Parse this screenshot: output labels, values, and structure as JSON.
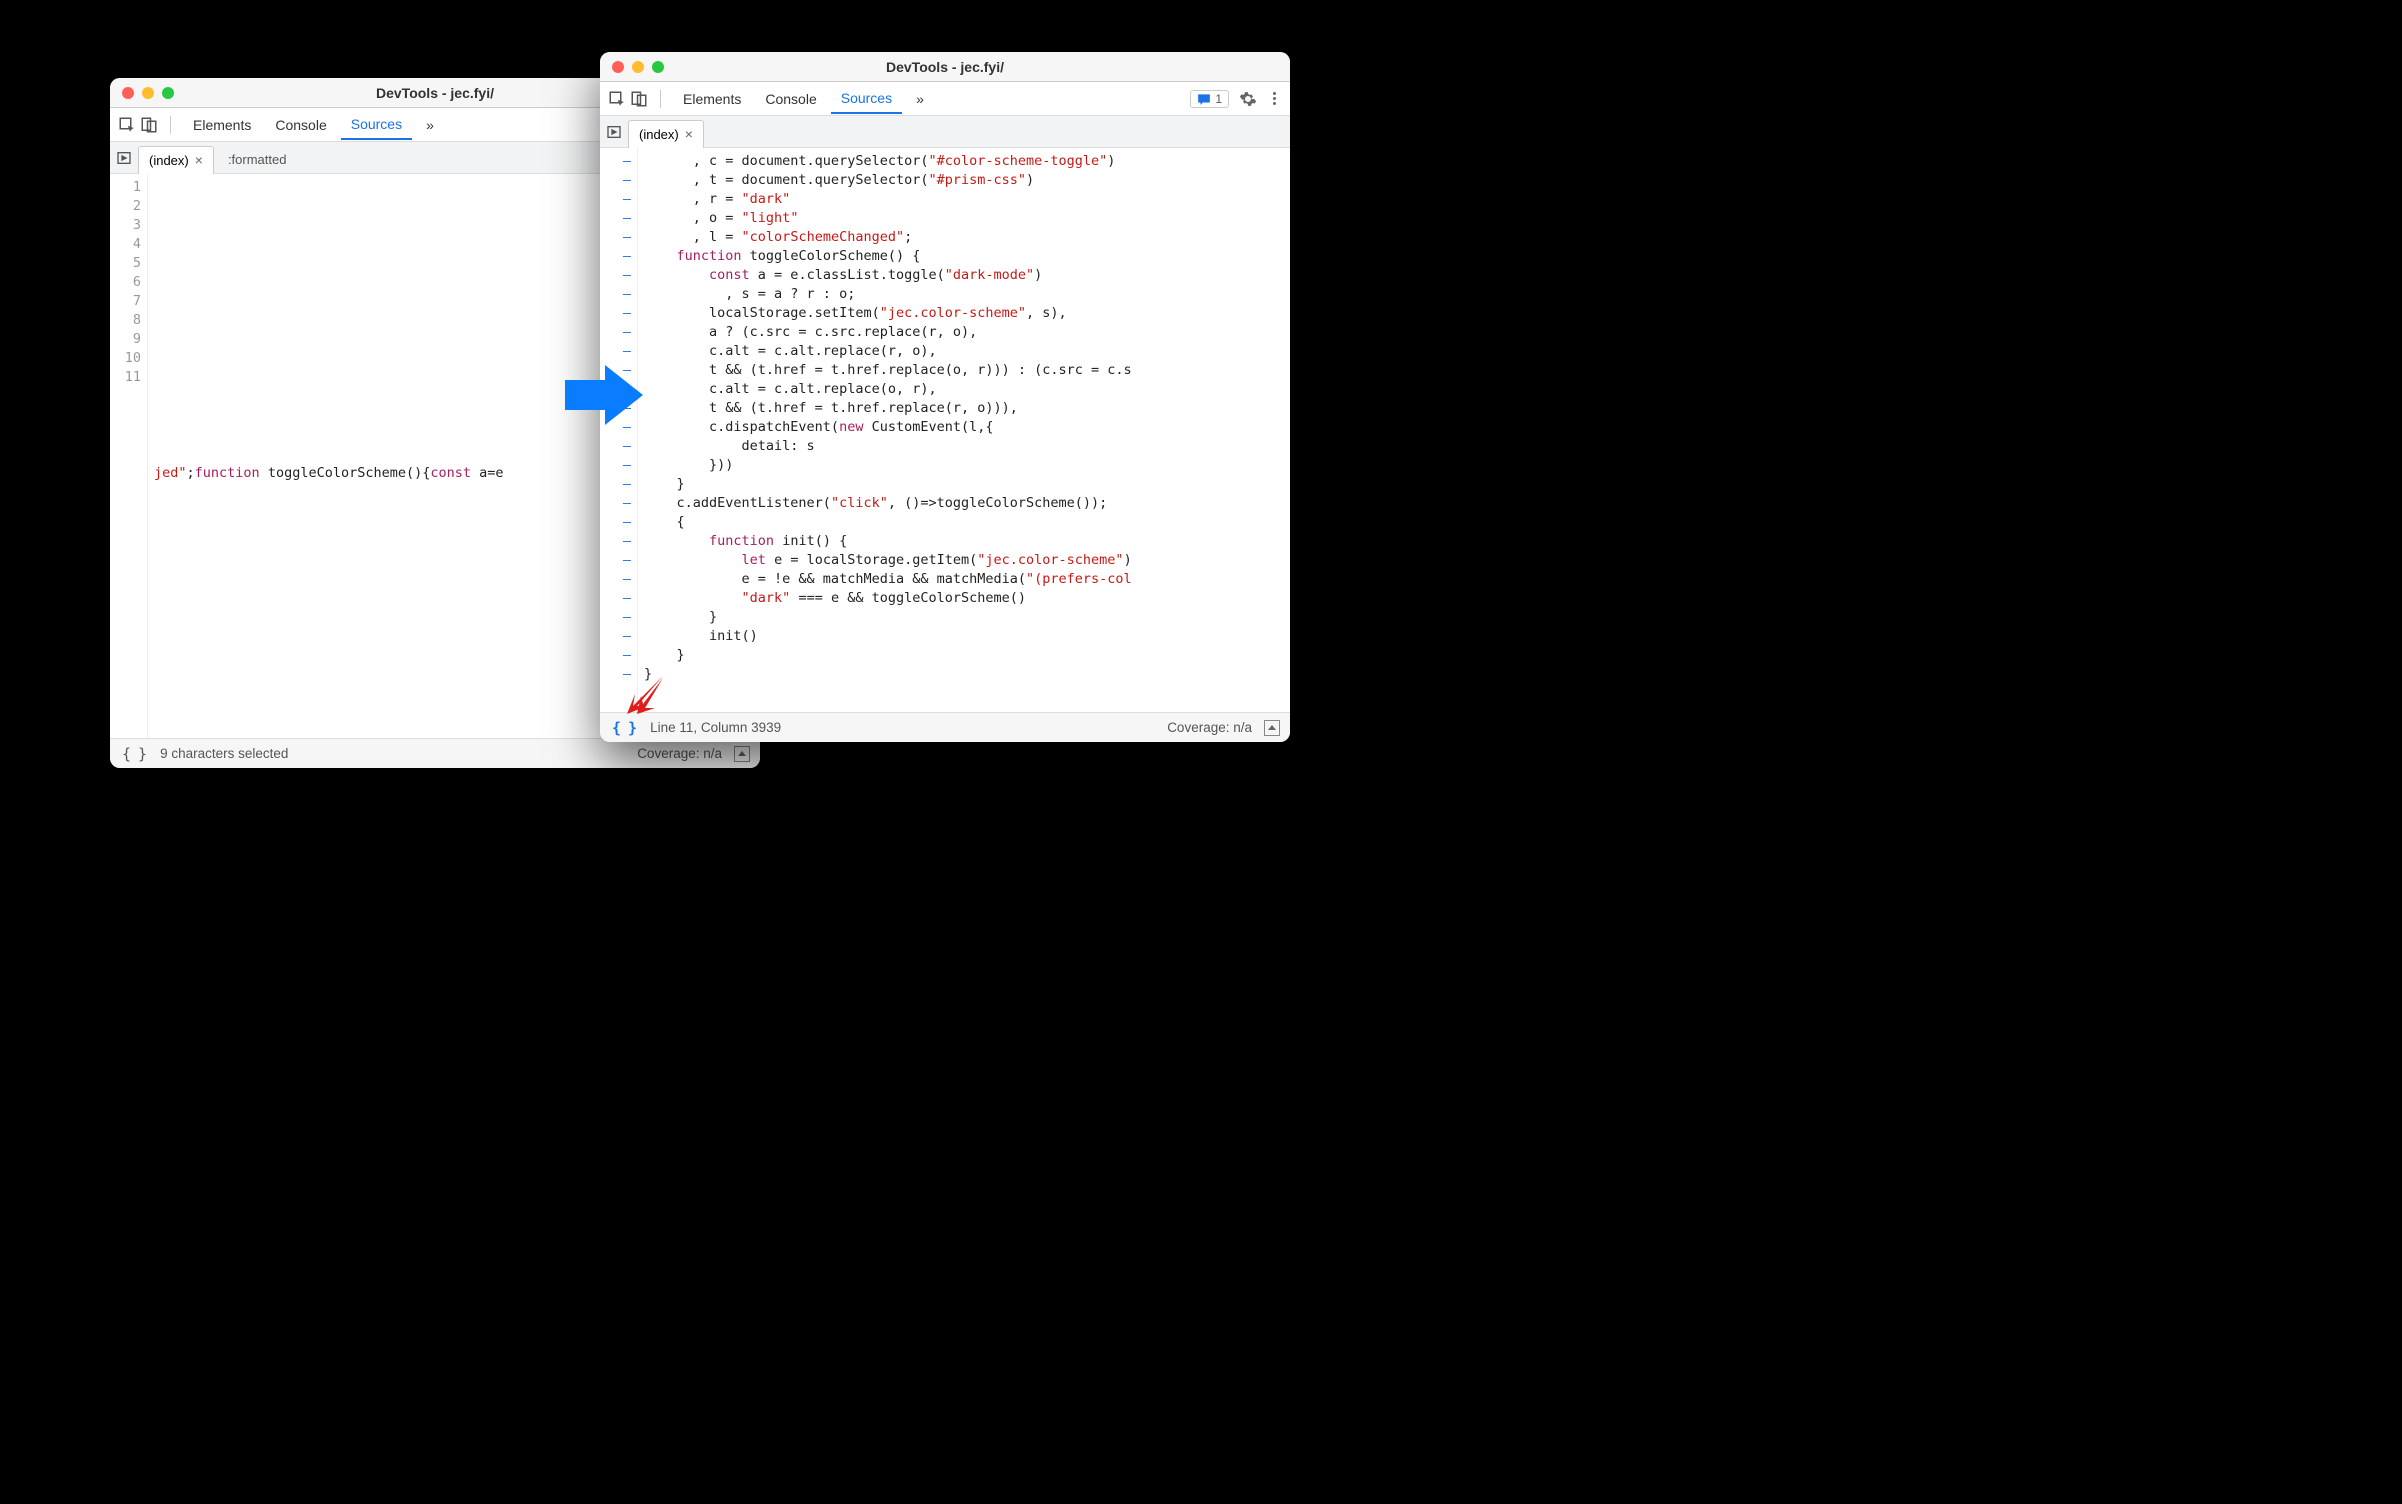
{
  "window_left": {
    "title": "DevTools - jec.fyi/",
    "tabs": {
      "elements": "Elements",
      "console": "Console",
      "sources": "Sources"
    },
    "file_tab": "(index)",
    "formatted_tab": ":formatted",
    "gutter": [
      "1",
      "2",
      "3",
      "4",
      "5",
      "6",
      "7",
      "8",
      "9",
      "10",
      "11"
    ],
    "line11": {
      "frag1": "jed\"",
      "semi": ";",
      "kw_func": "function",
      "name": " toggleColorScheme(){",
      "kw_const": "const",
      "tail": " a=e"
    },
    "status": {
      "left": "9 characters selected",
      "right": "Coverage: n/a"
    }
  },
  "window_right": {
    "title": "DevTools - jec.fyi/",
    "tabs": {
      "elements": "Elements",
      "console": "Console",
      "sources": "Sources"
    },
    "file_tab": "(index)",
    "badge_count": "1",
    "status": {
      "left": "Line 11, Column 3939",
      "right": "Coverage: n/a"
    },
    "code_lines": [
      [
        {
          "t": "      , c = document.querySelector("
        },
        {
          "t": "\"#color-scheme-toggle\"",
          "c": "str"
        },
        {
          "t": ")"
        }
      ],
      [
        {
          "t": "      , t = document.querySelector("
        },
        {
          "t": "\"#prism-css\"",
          "c": "str"
        },
        {
          "t": ")"
        }
      ],
      [
        {
          "t": "      , r = "
        },
        {
          "t": "\"dark\"",
          "c": "str"
        }
      ],
      [
        {
          "t": "      , o = "
        },
        {
          "t": "\"light\"",
          "c": "str"
        }
      ],
      [
        {
          "t": "      , l = "
        },
        {
          "t": "\"colorSchemeChanged\"",
          "c": "str"
        },
        {
          "t": ";"
        }
      ],
      [
        {
          "t": "    "
        },
        {
          "t": "function",
          "c": "kw"
        },
        {
          "t": " toggleColorScheme() {"
        }
      ],
      [
        {
          "t": "        "
        },
        {
          "t": "const",
          "c": "kw"
        },
        {
          "t": " a = e.classList.toggle("
        },
        {
          "t": "\"dark-mode\"",
          "c": "str"
        },
        {
          "t": ")"
        }
      ],
      [
        {
          "t": "          , s = a ? r : o;"
        }
      ],
      [
        {
          "t": "        localStorage.setItem("
        },
        {
          "t": "\"jec.color-scheme\"",
          "c": "str"
        },
        {
          "t": ", s),"
        }
      ],
      [
        {
          "t": "        a ? (c.src = c.src.replace(r, o),"
        }
      ],
      [
        {
          "t": "        c.alt = c.alt.replace(r, o),"
        }
      ],
      [
        {
          "t": "        t && (t.href = t.href.replace(o, r))) : (c.src = c.s"
        }
      ],
      [
        {
          "t": "        c.alt = c.alt.replace(o, r),"
        }
      ],
      [
        {
          "t": "        t && (t.href = t.href.replace(r, o))),"
        }
      ],
      [
        {
          "t": "        c.dispatchEvent("
        },
        {
          "t": "new",
          "c": "kw"
        },
        {
          "t": " CustomEvent(l,{"
        }
      ],
      [
        {
          "t": "            detail: s"
        }
      ],
      [
        {
          "t": "        }))"
        }
      ],
      [
        {
          "t": "    }"
        }
      ],
      [
        {
          "t": "    c.addEventListener("
        },
        {
          "t": "\"click\"",
          "c": "str"
        },
        {
          "t": ", ()=>toggleColorScheme());"
        }
      ],
      [
        {
          "t": "    {"
        }
      ],
      [
        {
          "t": "        "
        },
        {
          "t": "function",
          "c": "kw"
        },
        {
          "t": " init() {"
        }
      ],
      [
        {
          "t": "            "
        },
        {
          "t": "let",
          "c": "kw"
        },
        {
          "t": " e = localStorage.getItem("
        },
        {
          "t": "\"jec.color-scheme\"",
          "c": "str"
        },
        {
          "t": ")"
        }
      ],
      [
        {
          "t": "            e = !e && matchMedia && matchMedia("
        },
        {
          "t": "\"(prefers-col",
          "c": "str"
        }
      ],
      [
        {
          "t": "            "
        },
        {
          "t": "\"dark\"",
          "c": "str"
        },
        {
          "t": " === e && toggleColorScheme()"
        }
      ],
      [
        {
          "t": "        }"
        }
      ],
      [
        {
          "t": "        init()"
        }
      ],
      [
        {
          "t": "    }"
        }
      ],
      [
        {
          "t": "}"
        }
      ]
    ]
  }
}
